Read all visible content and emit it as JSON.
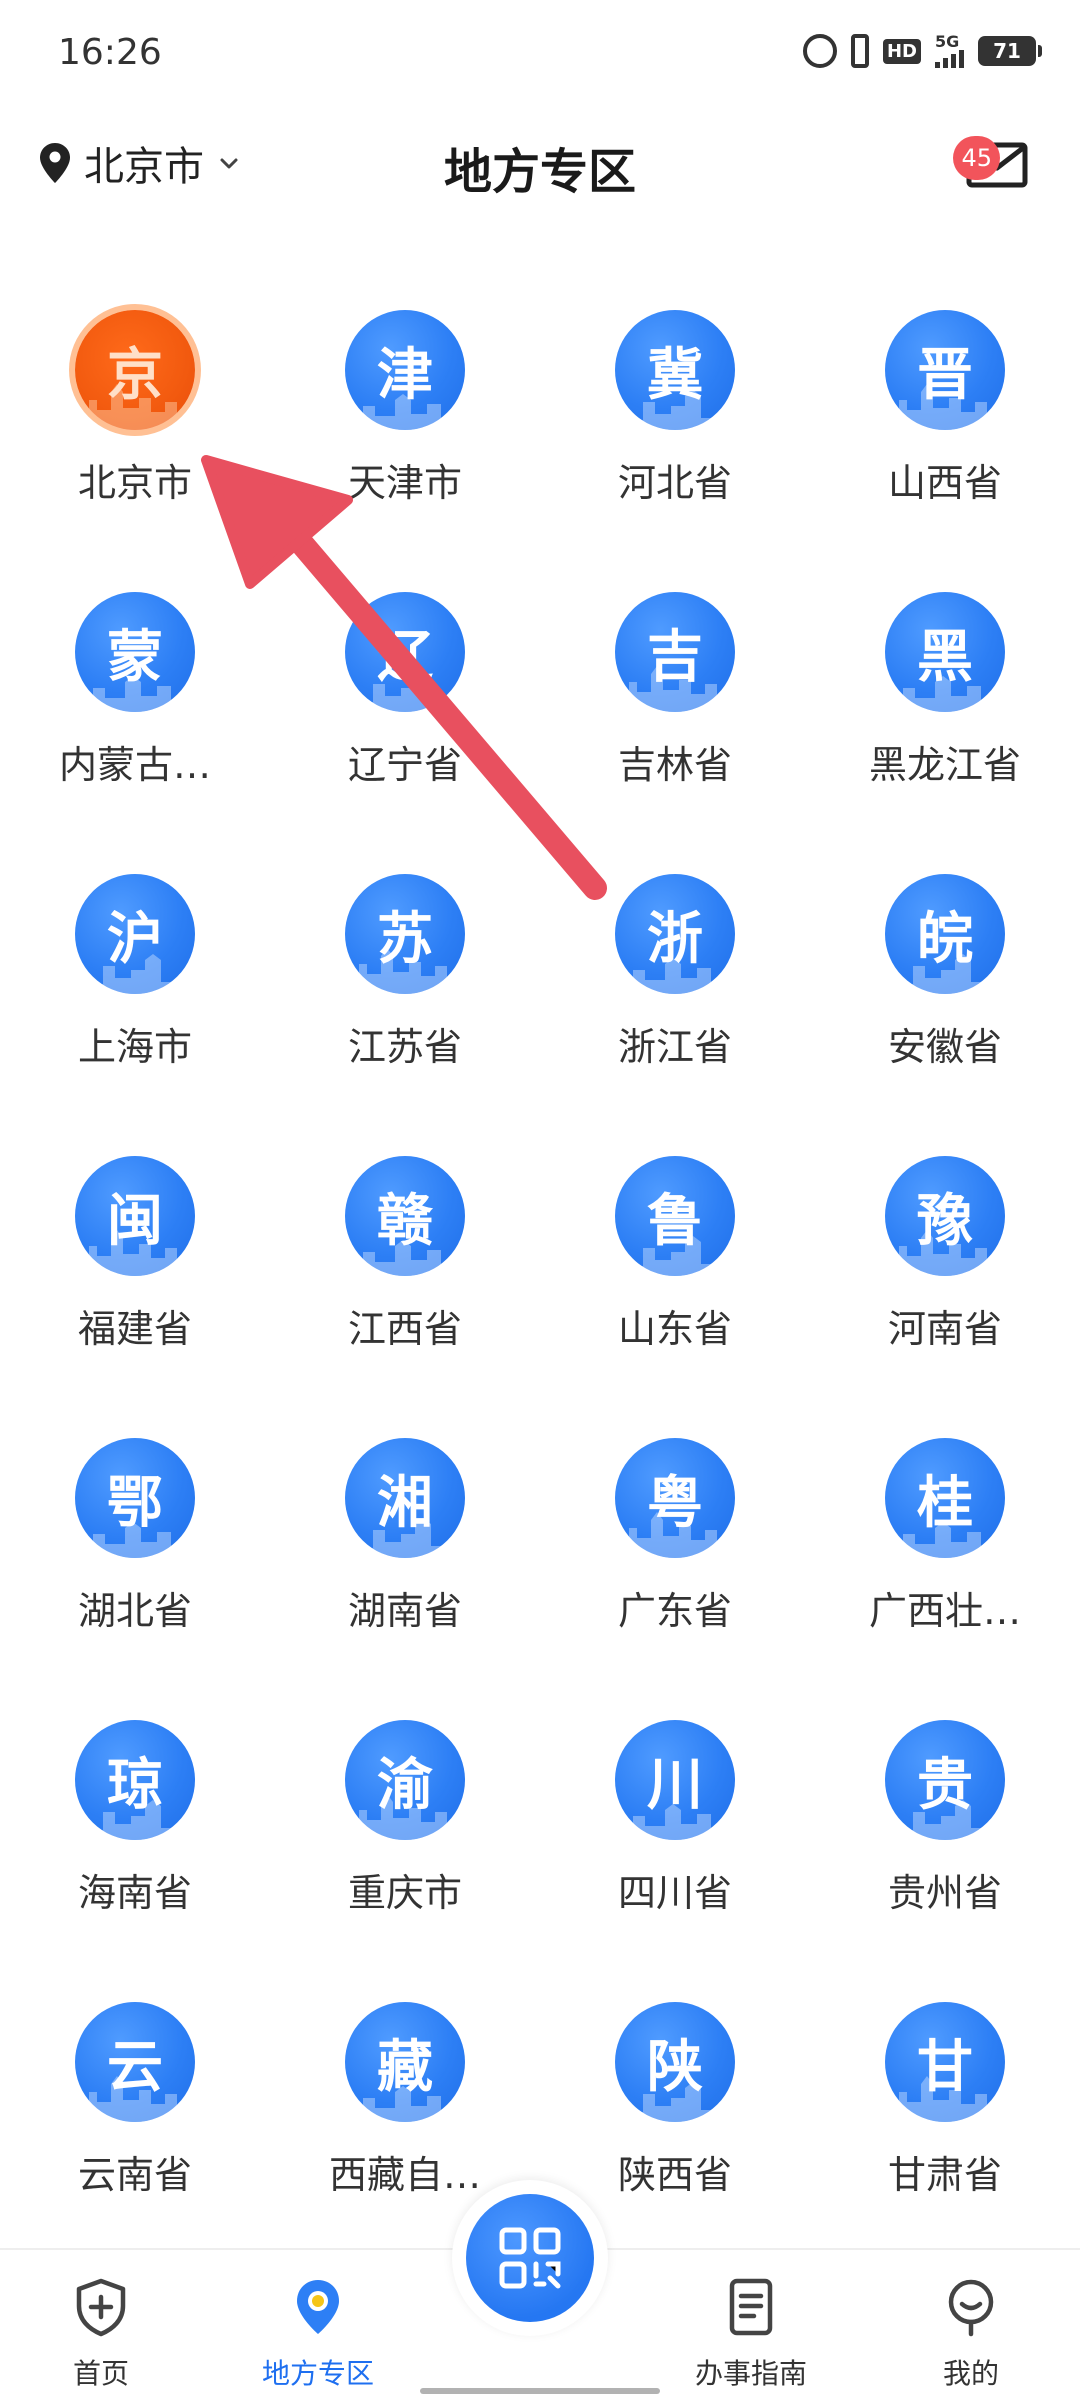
{
  "status_bar": {
    "time": "16:26",
    "hd": "HD",
    "network": "5G",
    "battery": "71"
  },
  "header": {
    "location": "北京市",
    "title": "地方专区",
    "mail_badge": "45"
  },
  "regions": [
    {
      "char": "京",
      "label": "北京市",
      "active": true
    },
    {
      "char": "津",
      "label": "天津市"
    },
    {
      "char": "冀",
      "label": "河北省"
    },
    {
      "char": "晋",
      "label": "山西省"
    },
    {
      "char": "蒙",
      "label": "内蒙古…"
    },
    {
      "char": "辽",
      "label": "辽宁省"
    },
    {
      "char": "吉",
      "label": "吉林省"
    },
    {
      "char": "黑",
      "label": "黑龙江省"
    },
    {
      "char": "沪",
      "label": "上海市"
    },
    {
      "char": "苏",
      "label": "江苏省"
    },
    {
      "char": "浙",
      "label": "浙江省"
    },
    {
      "char": "皖",
      "label": "安徽省"
    },
    {
      "char": "闽",
      "label": "福建省"
    },
    {
      "char": "赣",
      "label": "江西省"
    },
    {
      "char": "鲁",
      "label": "山东省"
    },
    {
      "char": "豫",
      "label": "河南省"
    },
    {
      "char": "鄂",
      "label": "湖北省"
    },
    {
      "char": "湘",
      "label": "湖南省"
    },
    {
      "char": "粤",
      "label": "广东省"
    },
    {
      "char": "桂",
      "label": "广西壮…"
    },
    {
      "char": "琼",
      "label": "海南省"
    },
    {
      "char": "渝",
      "label": "重庆市"
    },
    {
      "char": "川",
      "label": "四川省"
    },
    {
      "char": "贵",
      "label": "贵州省"
    },
    {
      "char": "云",
      "label": "云南省"
    },
    {
      "char": "藏",
      "label": "西藏自…"
    },
    {
      "char": "陕",
      "label": "陕西省"
    },
    {
      "char": "甘",
      "label": "甘肃省"
    }
  ],
  "bottom_nav": {
    "home": "首页",
    "local": "地方专区",
    "guide": "办事指南",
    "mine": "我的"
  },
  "colors": {
    "accent": "#2d7ff5",
    "active_region": "#f25a0f",
    "badge_red": "#f2545b",
    "arrow": "#e8505f"
  }
}
